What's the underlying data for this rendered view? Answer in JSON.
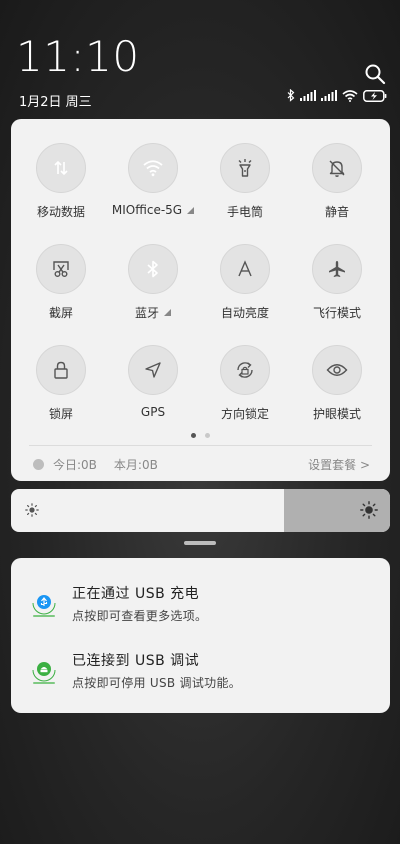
{
  "status": {
    "time": "11:10",
    "date": "1月2日 周三"
  },
  "icons": {
    "search": "search-icon",
    "bluetooth": "bluetooth-status-icon",
    "signal1": "cell-signal-icon",
    "signal2": "cell-signal-icon",
    "wifi": "wifi-status-icon",
    "battery": "battery-charging-icon"
  },
  "quick_settings": {
    "toggles": [
      {
        "id": "mobile-data",
        "label": "移动数据",
        "on": true,
        "icon": "mobile-data-icon"
      },
      {
        "id": "wifi",
        "label": "MIOffice-5G",
        "on": true,
        "icon": "wifi-icon",
        "has_caret": true
      },
      {
        "id": "flashlight",
        "label": "手电筒",
        "on": false,
        "icon": "flashlight-icon"
      },
      {
        "id": "mute",
        "label": "静音",
        "on": false,
        "icon": "bell-off-icon"
      },
      {
        "id": "screenshot",
        "label": "截屏",
        "on": false,
        "icon": "scissors-icon"
      },
      {
        "id": "bluetooth",
        "label": "蓝牙",
        "on": true,
        "icon": "bluetooth-icon",
        "has_caret": true
      },
      {
        "id": "auto-brightness",
        "label": "自动亮度",
        "on": false,
        "icon": "letter-a-icon"
      },
      {
        "id": "airplane",
        "label": "飞行模式",
        "on": false,
        "icon": "airplane-icon"
      },
      {
        "id": "lock-screen",
        "label": "锁屏",
        "on": false,
        "icon": "lock-icon"
      },
      {
        "id": "gps",
        "label": "GPS",
        "on": false,
        "icon": "navigation-arrow-icon"
      },
      {
        "id": "rotation-lock",
        "label": "方向锁定",
        "on": false,
        "icon": "rotation-lock-icon"
      },
      {
        "id": "eye-care",
        "label": "护眼模式",
        "on": false,
        "icon": "eye-icon"
      }
    ],
    "pages": 2,
    "active_page": 0,
    "data_usage": {
      "today": "今日:0B",
      "month": "本月:0B",
      "settings_link": "设置套餐 >"
    }
  },
  "brightness": {
    "level": 0.72
  },
  "notifications": [
    {
      "title": "正在通过 USB 充电",
      "body": "点按即可查看更多选项。",
      "icon": "usb-charging-app-icon",
      "accent": "#1a96f4"
    },
    {
      "title": "已连接到 USB 调试",
      "body": "点按即可停用 USB 调试功能。",
      "icon": "usb-debug-app-icon",
      "accent": "#3cb043"
    }
  ],
  "colors": {
    "accent_on": "#1a96f4",
    "panel_bg": "#f2f2f2"
  }
}
